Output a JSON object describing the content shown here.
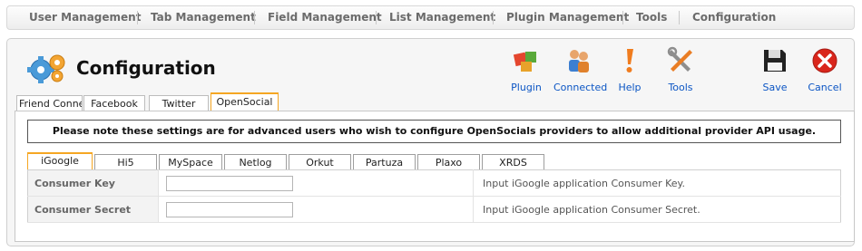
{
  "topnav": [
    "User Management",
    "Tab Management",
    "Field Management",
    "List Management",
    "Plugin Management",
    "Tools",
    "Configuration"
  ],
  "page": {
    "title": "Configuration"
  },
  "toolbar": {
    "plugin": "Plugin",
    "connected": "Connected",
    "help": "Help",
    "tools": "Tools",
    "save": "Save",
    "cancel": "Cancel"
  },
  "tabs": [
    "Friend Connect",
    "Facebook",
    "Twitter",
    "OpenSocial"
  ],
  "active_tab": "OpenSocial",
  "notice": "Please note these settings are for advanced users who wish to configure OpenSocials providers to allow additional provider API usage.",
  "provider_tabs": [
    "iGoogle",
    "Hi5",
    "MySpace",
    "Netlog",
    "Orkut",
    "Partuza",
    "Plaxo",
    "XRDS"
  ],
  "active_provider": "iGoogle",
  "fields": [
    {
      "label": "Consumer Key",
      "value": "",
      "description": "Input iGoogle application Consumer Key."
    },
    {
      "label": "Consumer Secret",
      "value": "",
      "description": "Input iGoogle application Consumer Secret."
    }
  ],
  "colors": {
    "link": "#0b55c4",
    "active_tab_border": "#f5a623",
    "cancel_red": "#d9261c"
  }
}
